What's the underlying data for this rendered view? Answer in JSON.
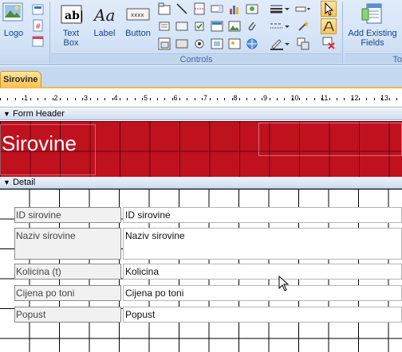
{
  "ribbon": {
    "logo_label": "Logo",
    "textbox_label": "Text Box",
    "textbox_line1": "Text",
    "textbox_line2": "Box",
    "label_label": "Label",
    "button_label": "Button",
    "add_fields_line1": "Add Existing",
    "add_fields_line2": "Fields",
    "controls_group": "Controls",
    "tools_group_partial": "To"
  },
  "document_tab": {
    "label": "Sirovine"
  },
  "ruler": {
    "numbers": [
      "1",
      "2",
      "3",
      "4",
      "5",
      "6",
      "7",
      "8",
      "9",
      "10",
      "11",
      "12",
      "13"
    ]
  },
  "sections": {
    "form_header": "Form Header",
    "detail": "Detail"
  },
  "form_header": {
    "title": "Sirovine"
  },
  "detail": {
    "fields": [
      {
        "label": "ID sirovine",
        "control": "ID sirovine"
      },
      {
        "label": "Naziv sirovine",
        "control": "Naziv sirovine"
      },
      {
        "label": "Kolicina (t)",
        "control": "Kolicina"
      },
      {
        "label": "Cijena po toni",
        "control": "Cijena po toni"
      },
      {
        "label": "Popust",
        "control": "Popust"
      }
    ]
  },
  "colors": {
    "header_band": "#c0111f",
    "ribbon_bg": "#d5e4f7",
    "tab_active": "#ffc04d"
  }
}
